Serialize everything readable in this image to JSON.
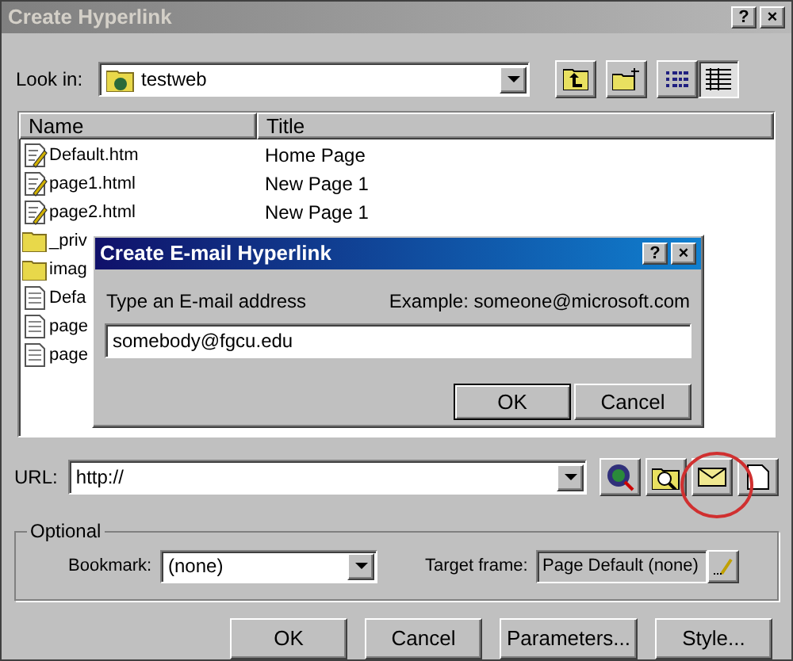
{
  "window": {
    "title": "Create Hyperlink",
    "help": "?",
    "close": "×"
  },
  "look_in": {
    "label": "Look in:",
    "value": "testweb"
  },
  "file_list": {
    "columns": [
      "Name",
      "Title"
    ],
    "rows": [
      {
        "kind": "page-edit",
        "name": "Default.htm",
        "title": "Home Page"
      },
      {
        "kind": "page-edit",
        "name": "page1.html",
        "title": "New Page 1"
      },
      {
        "kind": "page-edit",
        "name": "page2.html",
        "title": "New Page 1"
      },
      {
        "kind": "folder",
        "name": "_priv",
        "title": ""
      },
      {
        "kind": "folder",
        "name": "imag",
        "title": ""
      },
      {
        "kind": "page",
        "name": "Defa",
        "title": ""
      },
      {
        "kind": "page",
        "name": "page",
        "title": ""
      },
      {
        "kind": "page",
        "name": "page",
        "title": ""
      }
    ]
  },
  "email_dialog": {
    "title": "Create E-mail Hyperlink",
    "help": "?",
    "close": "×",
    "prompt": "Type an E-mail address",
    "example": "Example: someone@microsoft.com",
    "value": "somebody@fgcu.edu",
    "buttons": [
      "OK",
      "Cancel"
    ]
  },
  "url": {
    "label": "URL:",
    "value": "http://"
  },
  "optional": {
    "legend": "Optional",
    "bookmark_label": "Bookmark:",
    "bookmark_value": "(none)",
    "target_label": "Target frame:",
    "target_value": "Page Default (none)"
  },
  "buttons": [
    "OK",
    "Cancel",
    "Parameters...",
    "Style..."
  ]
}
